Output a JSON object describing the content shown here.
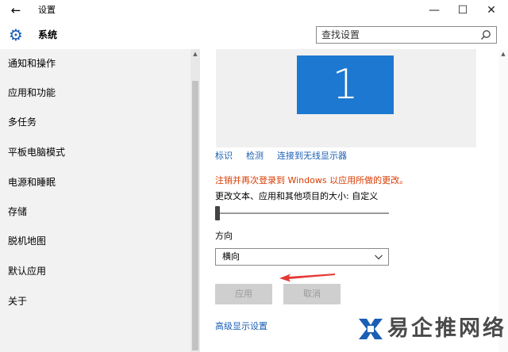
{
  "window": {
    "back_glyph": "←",
    "title": "设置",
    "minimize_glyph": "—",
    "maximize_glyph": "☐",
    "close_glyph": "✕"
  },
  "header": {
    "icon": "gear-icon",
    "title": "系统",
    "search_placeholder": "查找设置",
    "search_icon": "search-icon"
  },
  "sidebar": {
    "items": [
      {
        "label": "通知和操作"
      },
      {
        "label": "应用和功能"
      },
      {
        "label": "多任务"
      },
      {
        "label": "平板电脑模式"
      },
      {
        "label": "电源和睡眠"
      },
      {
        "label": "存储"
      },
      {
        "label": "脱机地图"
      },
      {
        "label": "默认应用"
      },
      {
        "label": "关于"
      }
    ]
  },
  "display": {
    "monitor_number": "1",
    "links": [
      "标识",
      "检测",
      "连接到无线显示器"
    ],
    "warning": "注销并再次登录到 Windows 以应用所做的更改。",
    "scale_label": "更改文本、应用和其他项目的大小: 自定义",
    "scale_level": 0,
    "orientation_label": "方向",
    "orientation_value": "横向",
    "apply_button": "应用",
    "cancel_button": "取消",
    "advanced_link": "高级显示设置"
  },
  "watermark": {
    "text": "易企推网络"
  },
  "colors": {
    "accent": "#1a5fb4",
    "monitor": "#1c78d0",
    "warning": "#d83b01",
    "annotation_arrow": "#e53935"
  }
}
